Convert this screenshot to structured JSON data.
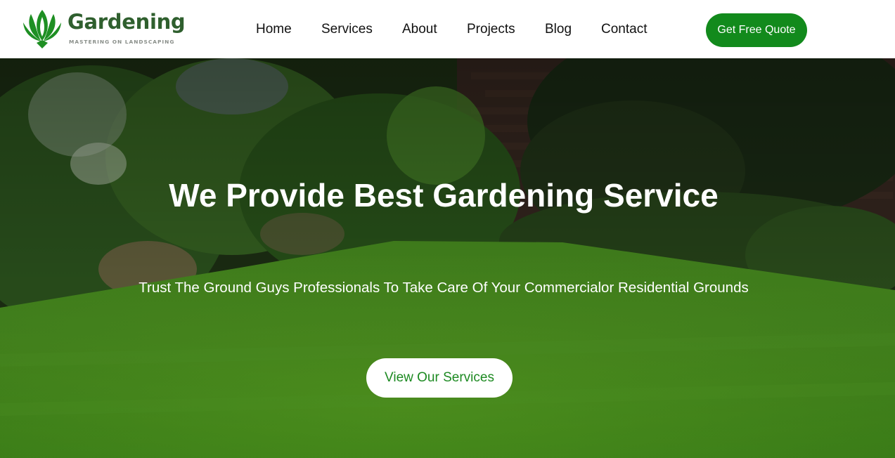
{
  "brand": {
    "name": "Gardening",
    "tagline": "MASTERING ON LANDSCAPING",
    "logo_icon": "lotus-leaf-icon",
    "primary_color": "#128a1c",
    "logo_text_color": "#2f5f2e"
  },
  "nav": {
    "items": [
      {
        "label": "Home"
      },
      {
        "label": "Services"
      },
      {
        "label": "About"
      },
      {
        "label": "Projects"
      },
      {
        "label": "Blog"
      },
      {
        "label": "Contact"
      }
    ]
  },
  "header": {
    "cta_label": "Get Free Quote"
  },
  "hero": {
    "title": "We Provide Best Gardening Service",
    "subtitle": "Trust The Ground Guys Professionals To Take Care Of Your Commercialor Residential Grounds",
    "button_label": "View Our Services",
    "background": "garden-lawn-photo"
  }
}
